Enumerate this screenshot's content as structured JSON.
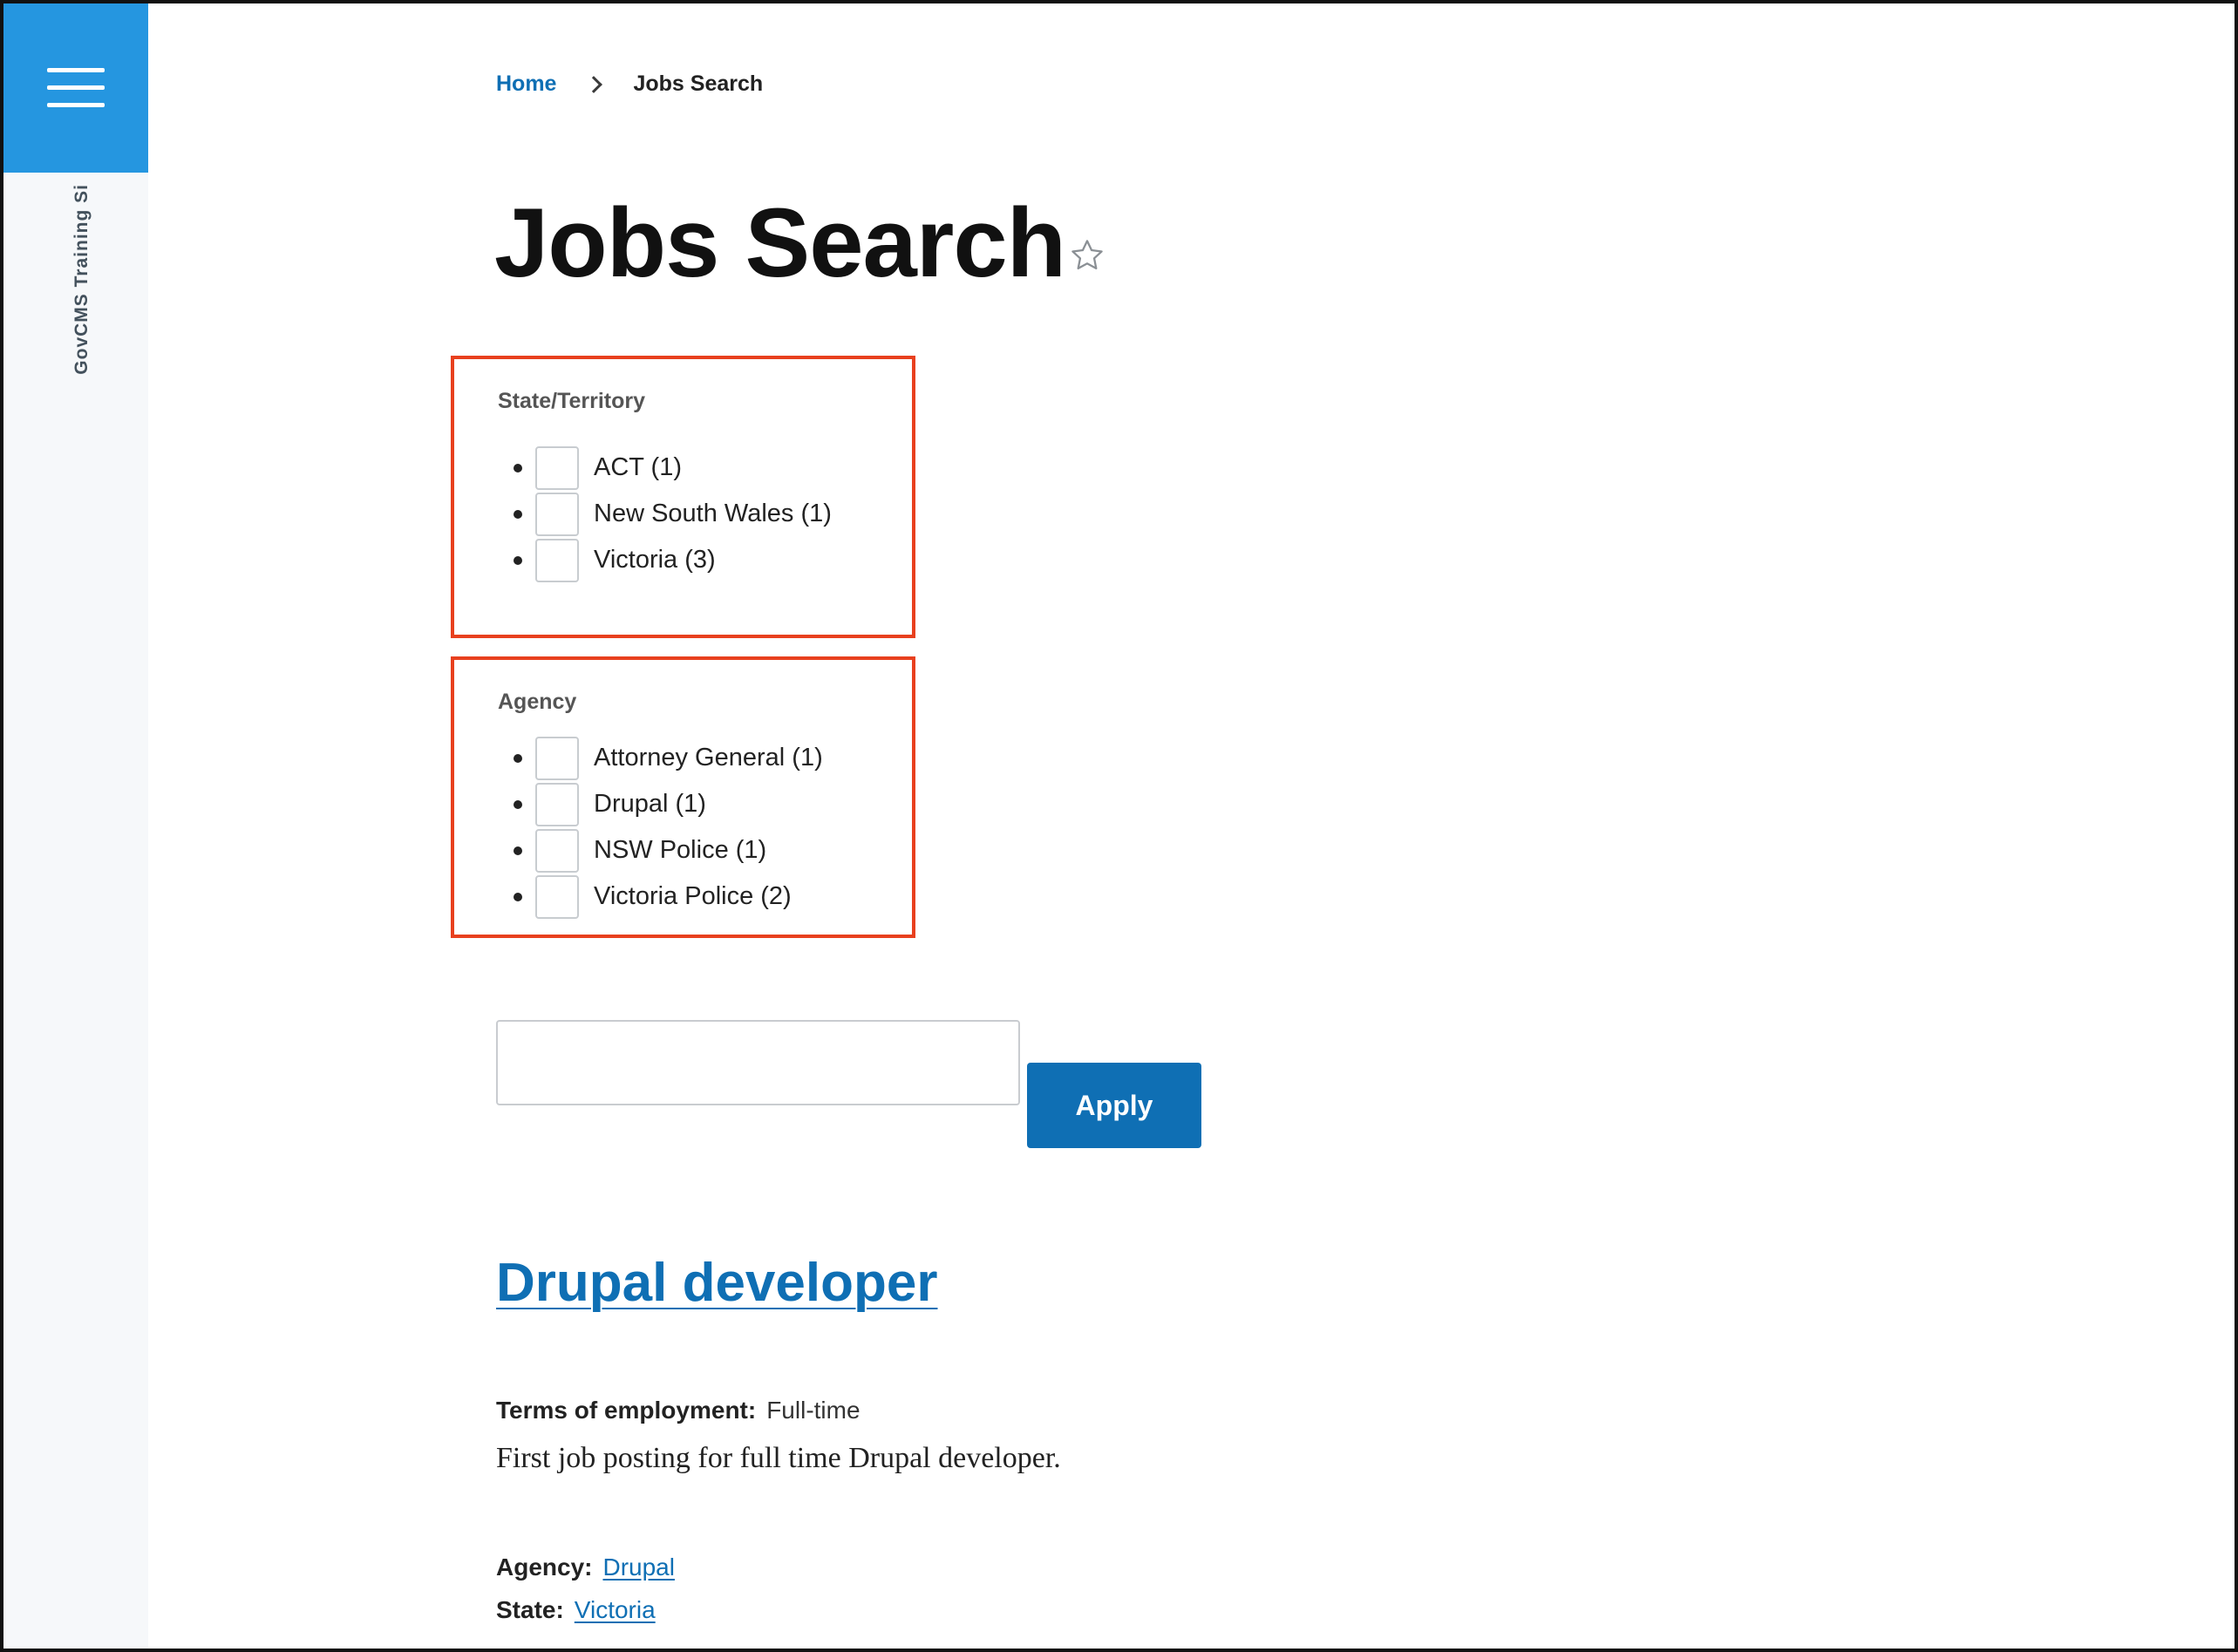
{
  "sidebar": {
    "menu_icon": "hamburger-menu-icon",
    "site_name": "GovCMS Training Si"
  },
  "breadcrumb": {
    "home": "Home",
    "separator_icon": "chevron-right-icon",
    "current": "Jobs Search"
  },
  "page": {
    "title": "Jobs Search",
    "favorite_icon": "star-outline-icon"
  },
  "facets": {
    "state": {
      "title": "State/Territory",
      "items": [
        {
          "label": "ACT (1)"
        },
        {
          "label": "New South Wales (1)"
        },
        {
          "label": "Victoria (3)"
        }
      ]
    },
    "agency": {
      "title": "Agency",
      "items": [
        {
          "label": "Attorney General (1)"
        },
        {
          "label": "Drupal (1)"
        },
        {
          "label": "NSW Police (1)"
        },
        {
          "label": "Victoria Police (2)"
        }
      ]
    }
  },
  "search": {
    "value": "",
    "apply_label": "Apply"
  },
  "results": [
    {
      "title": "Drupal developer",
      "terms_label": "Terms of employment:",
      "terms_value": "Full-time",
      "description": "First job posting for full time Drupal developer.",
      "agency_label": "Agency:",
      "agency_value": "Drupal",
      "state_label": "State:",
      "state_value": "Victoria"
    }
  ],
  "colors": {
    "brand_blue": "#2596e0",
    "link_blue": "#0f6fb4",
    "highlight_red": "#e8401e"
  }
}
